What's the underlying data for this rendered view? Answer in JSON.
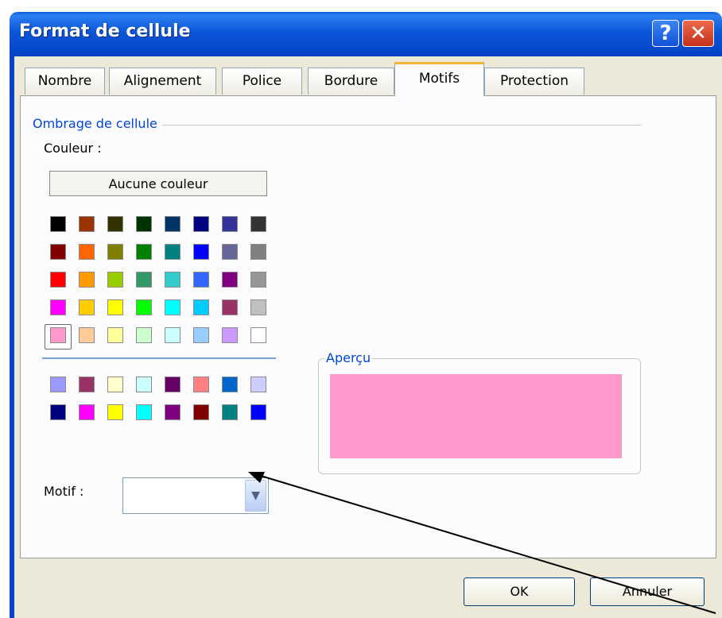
{
  "window": {
    "title": "Format de cellule",
    "help_label": "?",
    "close_label": "✕"
  },
  "tabs": [
    {
      "label": "Nombre"
    },
    {
      "label": "Alignement"
    },
    {
      "label": "Police"
    },
    {
      "label": "Bordure"
    },
    {
      "label": "Motifs",
      "active": true
    },
    {
      "label": "Protection"
    }
  ],
  "shading": {
    "group_label": "Ombrage de cellule",
    "color_label": "Couleur :",
    "no_color_label": "Aucune couleur",
    "selected_color": "#ff99cc",
    "palette": [
      [
        "#000000",
        "#993300",
        "#333300",
        "#003300",
        "#003366",
        "#000080",
        "#333399",
        "#333333"
      ],
      [
        "#800000",
        "#ff6600",
        "#808000",
        "#008000",
        "#008080",
        "#0000ff",
        "#666699",
        "#808080"
      ],
      [
        "#ff0000",
        "#ff9900",
        "#99cc00",
        "#339966",
        "#33cccc",
        "#3366ff",
        "#800080",
        "#969696"
      ],
      [
        "#ff00ff",
        "#ffcc00",
        "#ffff00",
        "#00ff00",
        "#00ffff",
        "#00ccff",
        "#993366",
        "#c0c0c0"
      ],
      [
        "#ff99cc",
        "#ffcc99",
        "#ffff99",
        "#ccffcc",
        "#ccffff",
        "#99ccff",
        "#cc99ff",
        "#ffffff"
      ]
    ],
    "extra_palette": [
      [
        "#9999ff",
        "#993366",
        "#ffffcc",
        "#ccffff",
        "#660066",
        "#ff8080",
        "#0066cc",
        "#ccccff"
      ],
      [
        "#000080",
        "#ff00ff",
        "#ffff00",
        "#00ffff",
        "#800080",
        "#800000",
        "#008080",
        "#0000ff"
      ]
    ],
    "pattern_label": "Motif :",
    "pattern_value": ""
  },
  "preview": {
    "label": "Aperçu",
    "color": "#ff99cc"
  },
  "buttons": {
    "ok": "OK",
    "cancel": "Annuler"
  }
}
